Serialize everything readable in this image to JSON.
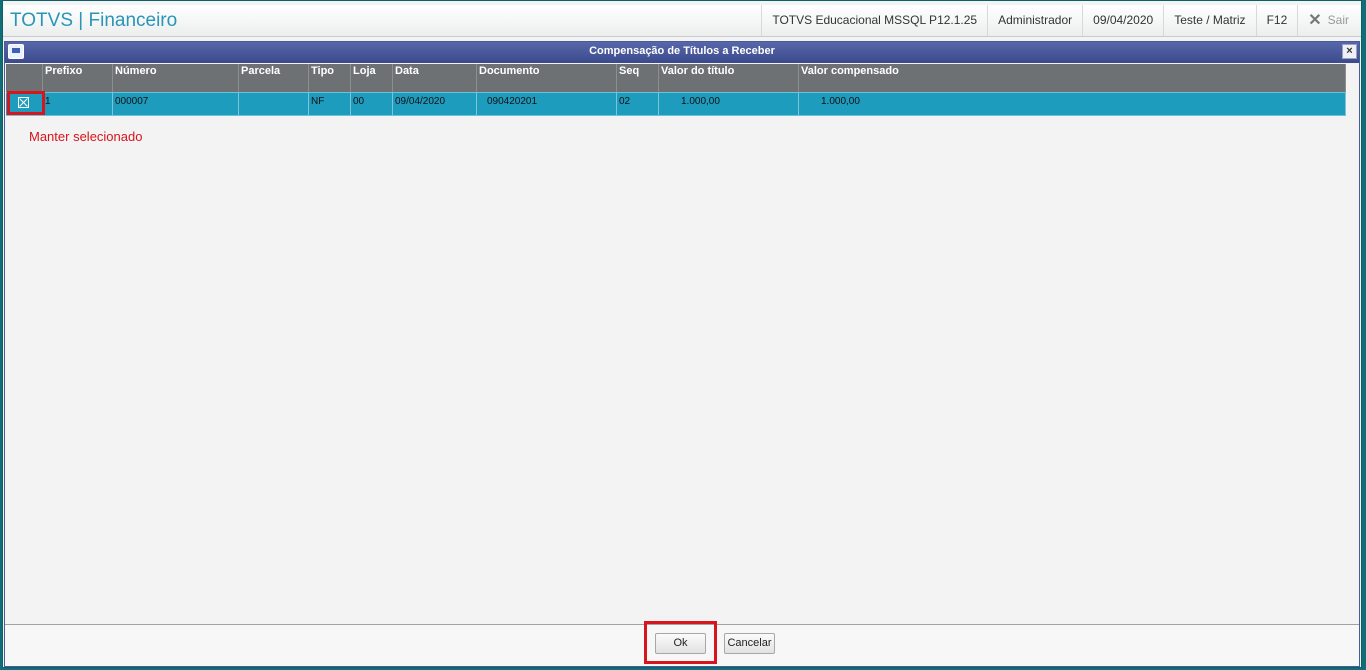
{
  "app": {
    "title": "TOTVS | Financeiro",
    "environment": "TOTVS Educacional MSSQL P12.1.25",
    "user": "Administrador",
    "date": "09/04/2020",
    "branch": "Teste / Matriz",
    "shortcut": "F12",
    "exit_label": "Sair"
  },
  "dialog": {
    "title": "Compensação de Títulos a Receber",
    "close_glyph": "×",
    "columns": [
      "",
      "Prefixo",
      "Número",
      "Parcela",
      "Tipo",
      "Loja",
      "Data",
      "Documento",
      "Seq",
      "Valor do título",
      "Valor compensado"
    ],
    "rows": [
      {
        "selected": true,
        "prefixo": "1",
        "numero": "000007",
        "parcela": "",
        "tipo": "NF",
        "loja": "00",
        "data": "09/04/2020",
        "documento": "090420201",
        "seq": "02",
        "valor_titulo": "1.000,00",
        "valor_compensado": "1.000,00"
      }
    ],
    "annotation": "Manter selecionado",
    "ok_label": "Ok",
    "cancel_label": "Cancelar"
  },
  "colors": {
    "header_title": "#2a95b8",
    "titlebar": "#4a5a9a",
    "selected_row": "#1d9cbe",
    "highlight": "#d8141c"
  }
}
